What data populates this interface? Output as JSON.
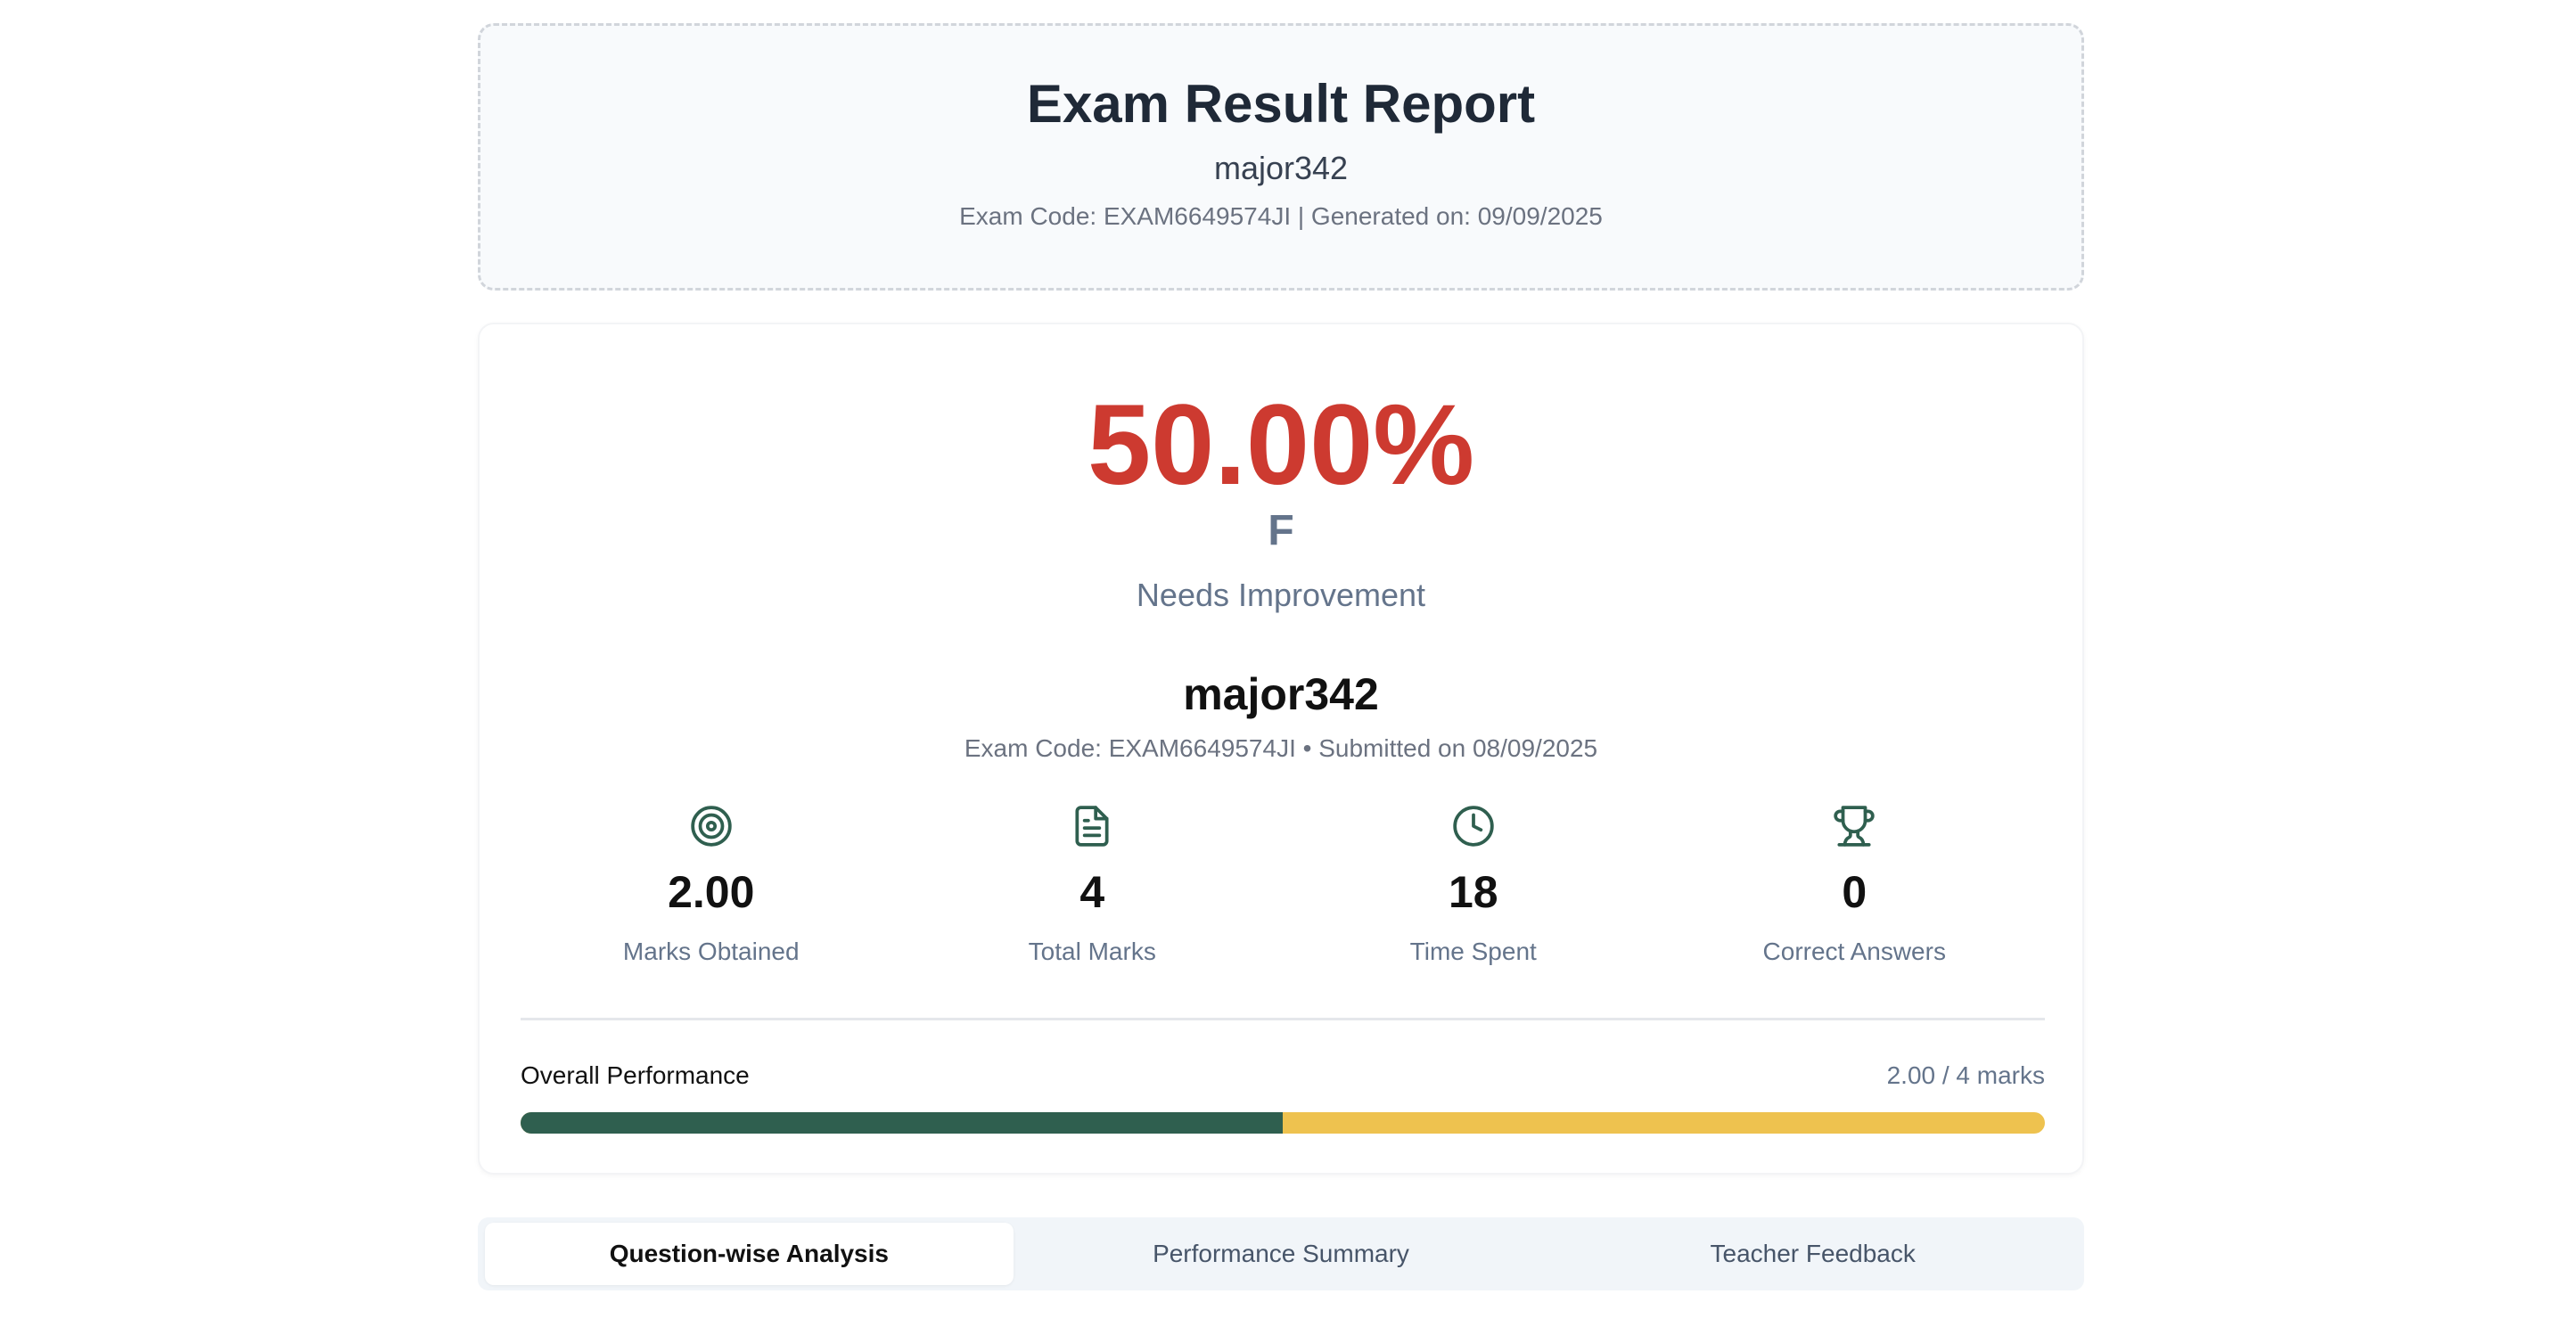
{
  "header": {
    "title": "Exam Result Report",
    "student_name": "major342",
    "meta": "Exam Code: EXAM6649574JI | Generated on: 09/09/2025"
  },
  "result": {
    "percentage": "50.00%",
    "grade": "F",
    "remark": "Needs Improvement",
    "student_name": "major342",
    "submit_meta": "Exam Code: EXAM6649574JI • Submitted on 08/09/2025",
    "percentage_color": "#cd3a30"
  },
  "stats": [
    {
      "icon": "target-icon",
      "value": "2.00",
      "label": "Marks Obtained"
    },
    {
      "icon": "document-icon",
      "value": "4",
      "label": "Total Marks"
    },
    {
      "icon": "clock-icon",
      "value": "18",
      "label": "Time Spent"
    },
    {
      "icon": "trophy-icon",
      "value": "0",
      "label": "Correct Answers"
    }
  ],
  "performance": {
    "label": "Overall Performance",
    "value_text": "2.00 / 4 marks",
    "fraction": 0.5,
    "fill_color": "#2f5f4f",
    "track_color": "#eec24f"
  },
  "tabs": [
    {
      "label": "Question-wise Analysis",
      "active": true
    },
    {
      "label": "Performance Summary",
      "active": false
    },
    {
      "label": "Teacher Feedback",
      "active": false
    }
  ],
  "colors": {
    "icon": "#2f5f4f"
  }
}
